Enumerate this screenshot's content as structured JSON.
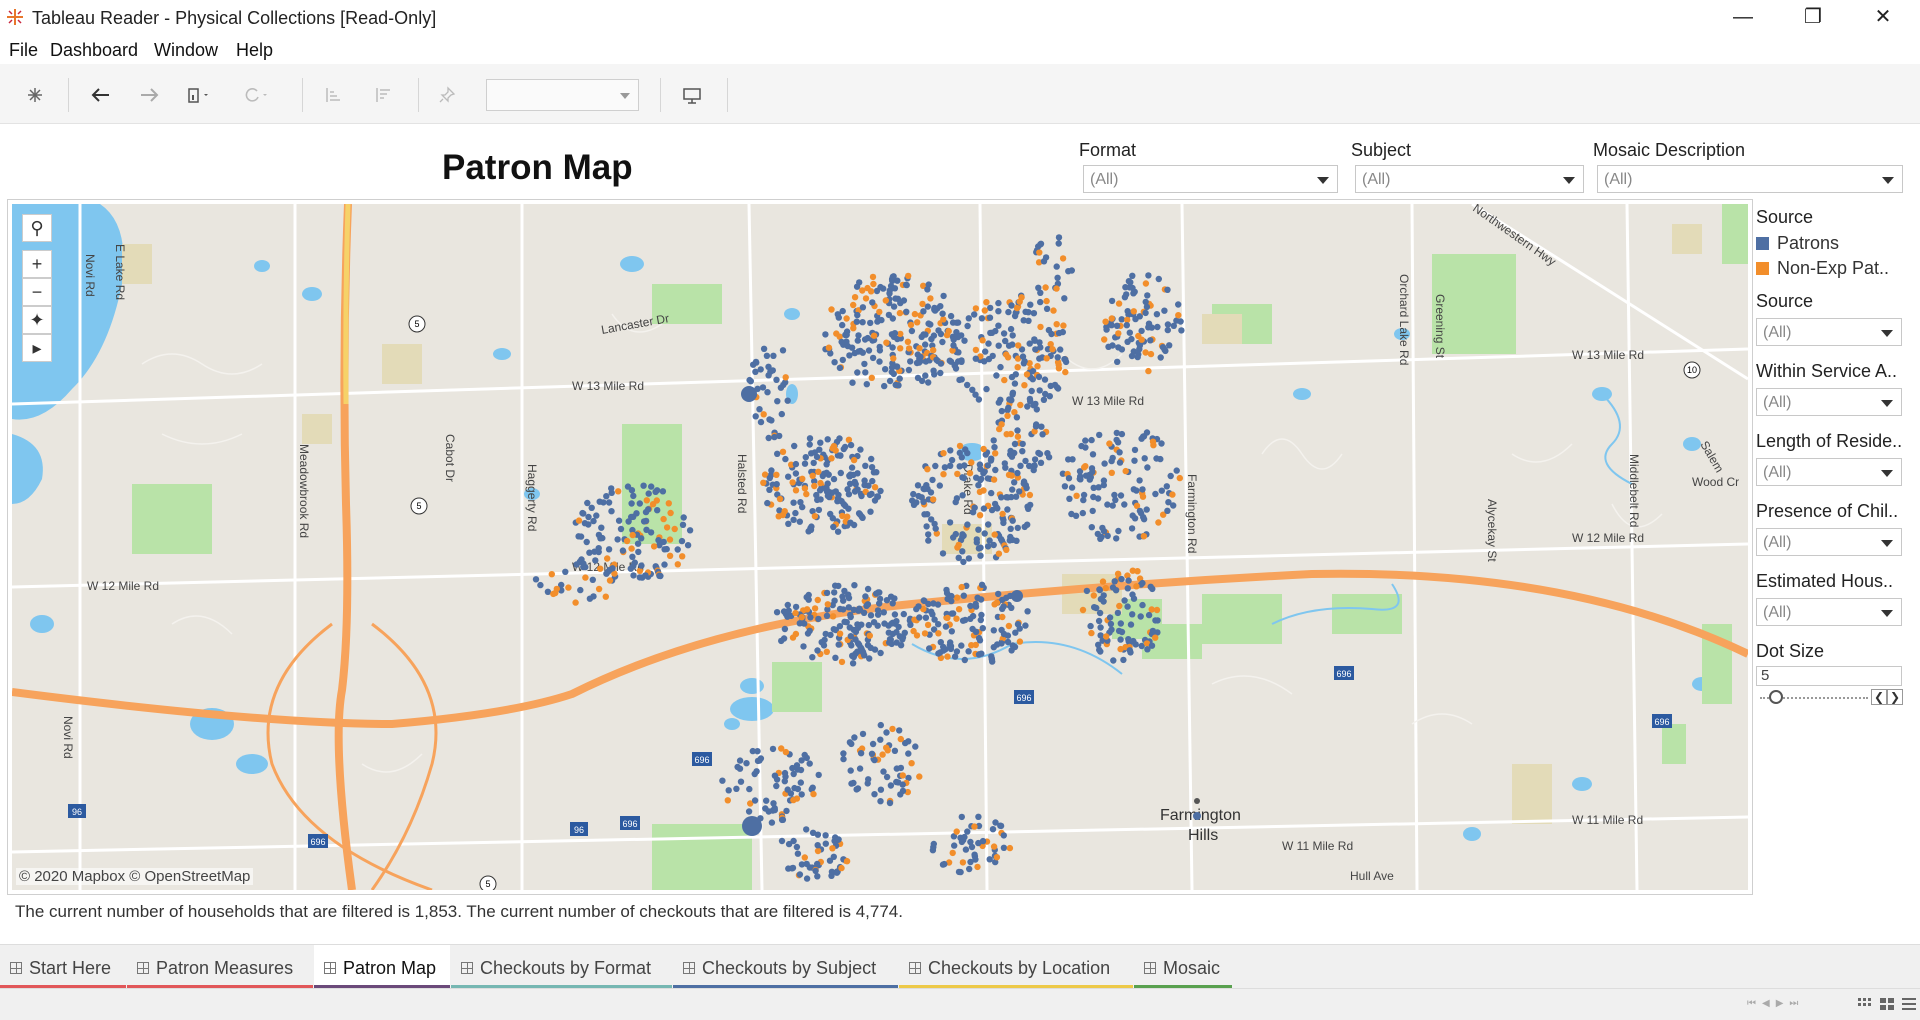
{
  "window": {
    "title": "Tableau Reader - Physical Collections [Read-Only]"
  },
  "menu": [
    "File",
    "Dashboard",
    "Window",
    "Help"
  ],
  "dashboard": {
    "title": "Patron Map"
  },
  "top_filters": [
    {
      "label": "Format",
      "value": "(All)"
    },
    {
      "label": "Subject",
      "value": "(All)"
    },
    {
      "label": "Mosaic Description",
      "value": "(All)"
    }
  ],
  "legend": {
    "title": "Source",
    "items": [
      {
        "label": "Patrons",
        "color": "#4e6fa3"
      },
      {
        "label": "Non-Exp Pat..",
        "color": "#f28e2b"
      }
    ]
  },
  "side_filters": [
    {
      "label": "Source",
      "value": "(All)"
    },
    {
      "label": "Within Service A..",
      "value": "(All)"
    },
    {
      "label": "Length of Reside..",
      "value": "(All)"
    },
    {
      "label": "Presence of Chil..",
      "value": "(All)"
    },
    {
      "label": "Estimated Hous..",
      "value": "(All)"
    }
  ],
  "dot_size": {
    "label": "Dot Size",
    "value": "5",
    "level_fraction": 0.15
  },
  "map": {
    "attribution": "© 2020 Mapbox © OpenStreetMap",
    "road_labels": [
      "W 13 Mile Rd",
      "W 13 Mile Rd",
      "W 12 Mile Rd",
      "W 12 Mile Rd",
      "W 12 Mile Rd",
      "W 11 Mile Rd",
      "W 11 Mile Rd",
      "Northwestern Hwy",
      "Orchard Lake Rd",
      "Middlebelt Rd",
      "Farmington Rd",
      "Drake Rd",
      "Halsted Rd",
      "Haggerty Rd",
      "Meadowbrook Rd",
      "Novi Rd",
      "Novi Rd",
      "E Lake Rd",
      "Cabot Dr",
      "Lancaster Dr",
      "Greening St",
      "Alycekay St",
      "Salem",
      "Wood Cr",
      "Hull Ave",
      "W 13 Mile Rd"
    ],
    "place_label_line1": "Farmington",
    "place_label_line2": "Hills",
    "shields": [
      "5",
      "5",
      "5",
      "10",
      "96",
      "696",
      "696",
      "696",
      "696",
      "696",
      "696",
      "96"
    ]
  },
  "caption": "The current number of households that are filtered is 1,853. The current number of checkouts that are filtered is 4,774.",
  "tabs": [
    {
      "label": "Start Here",
      "color": "#e15759",
      "active": false
    },
    {
      "label": "Patron Measures",
      "color": "#e15759",
      "active": false
    },
    {
      "label": "Patron Map",
      "color": "#6b4a7a",
      "active": true
    },
    {
      "label": "Checkouts by Format",
      "color": "#76b7b2",
      "active": false
    },
    {
      "label": "Checkouts by Subject",
      "color": "#4e6fa3",
      "active": false
    },
    {
      "label": "Checkouts by Location",
      "color": "#edc948",
      "active": false
    },
    {
      "label": "Mosaic",
      "color": "#59a14f",
      "active": false
    }
  ]
}
